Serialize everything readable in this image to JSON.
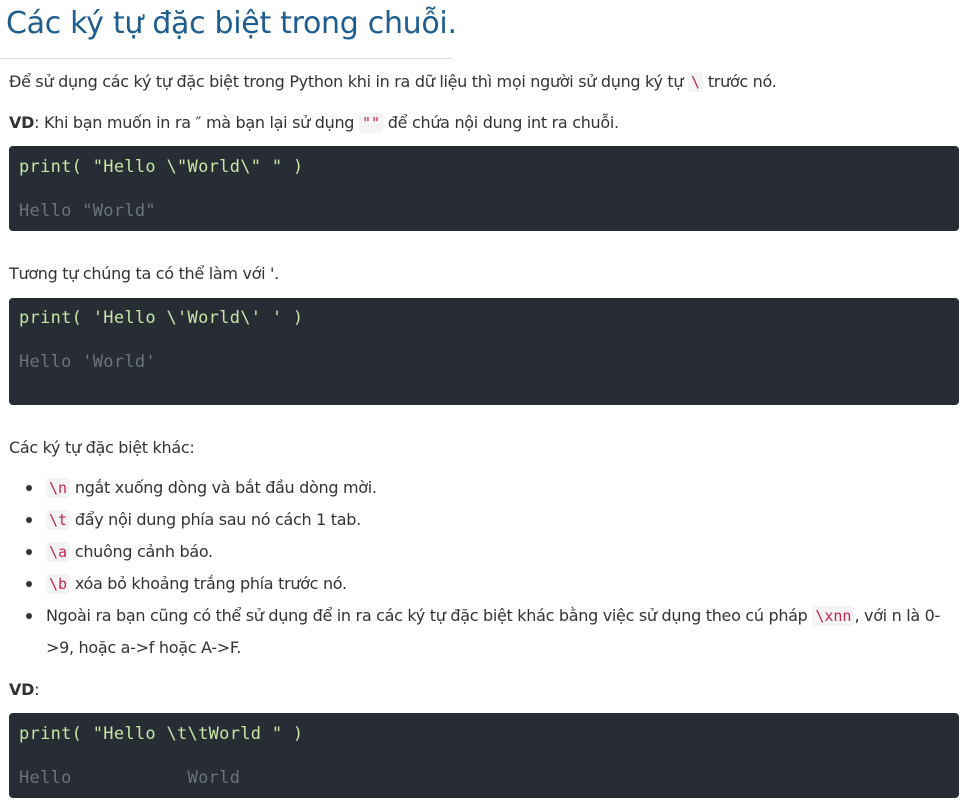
{
  "title": "Các ký tự đặc biệt trong chuỗi.",
  "intro": {
    "text_before": "Để sử dụng các ký tự đặc biệt trong Python khi in ra dữ liệu thì mọi người sử dụng ký tự ",
    "code": "\\",
    "text_after": " trước nó."
  },
  "vd1": {
    "label": "VD",
    "text_a": ": Khi bạn muốn in ra ″ mà bạn lại sử dụng ",
    "code": "\"\"",
    "text_b": " để chứa nội dung int ra chuỗi."
  },
  "code_blocks": [
    {
      "code": "print( \"Hello \\\"World\\\" \" )",
      "output": "Hello \"World\""
    },
    {
      "code": "print( 'Hello \\'World\\' ' )",
      "output": "Hello 'World'"
    },
    {
      "code": "print( \"Hello \\t\\tWorld \" )",
      "output": "Hello           World"
    }
  ],
  "similar": "Tương tự chúng ta có thể làm với '.",
  "others_heading": "Các ký tự đặc biệt khác:",
  "escapes": [
    {
      "code": "\\n",
      "text": " ngắt xuống dòng và bắt đầu dòng mời."
    },
    {
      "code": "\\t",
      "text": " đẩy nội dung phía sau nó cách 1 tab."
    },
    {
      "code": "\\a",
      "text": " chuông cảnh báo."
    },
    {
      "code": "\\b",
      "text": " xóa bỏ khoảng trắng phía trước nó."
    }
  ],
  "hex_item": {
    "text_before": "Ngoài ra bạn cũng có thể sử dụng để in ra các ký tự đặc biệt khác bằng việc sử dụng theo cú pháp ",
    "code": "\\xnn",
    "text_after": ", với n là 0->9, hoặc a->f hoặc A->F."
  },
  "vd2": "VD",
  "vd2_suffix": ":"
}
